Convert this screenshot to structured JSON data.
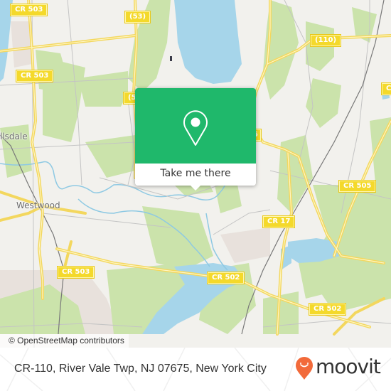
{
  "map": {
    "attribution": "© OpenStreetMap contributors",
    "colors": {
      "land": "#f2f1ed",
      "park": "#c9e2a8",
      "water": "#a6d5ea",
      "urban": "#e8e0dc",
      "road_major": "#f6e27a",
      "road_minor": "#bdbdbd",
      "rail": "#777777"
    },
    "road_shields": [
      {
        "label": "CR 503",
        "id": "cr503-top"
      },
      {
        "label": "(53)",
        "id": "route53-top"
      },
      {
        "label": "(110)",
        "id": "route110"
      },
      {
        "label": "C",
        "id": "cr-right-top"
      },
      {
        "label": "CR 503",
        "id": "cr503-left"
      },
      {
        "label": "(5",
        "id": "route5-partial"
      },
      {
        "label": "5",
        "id": "route-partial-right"
      },
      {
        "label": "CR 505",
        "id": "cr505"
      },
      {
        "label": "CR 17",
        "id": "cr17"
      },
      {
        "label": "CR 503",
        "id": "cr503-bottom"
      },
      {
        "label": "CR 502",
        "id": "cr502-center"
      },
      {
        "label": "CR 502",
        "id": "cr502-right"
      }
    ],
    "places": [
      {
        "label": "llsdale",
        "id": "hillsdale"
      },
      {
        "label": "Westwood",
        "id": "westwood"
      }
    ]
  },
  "popup": {
    "icon": "location-pin-icon",
    "button_label": "Take me there",
    "accent": "#1fb86b"
  },
  "footer": {
    "address": "CR-110, River Vale Twp, NJ 07675, New York City",
    "brand": "moovit",
    "brand_color": "#f26a3a"
  }
}
